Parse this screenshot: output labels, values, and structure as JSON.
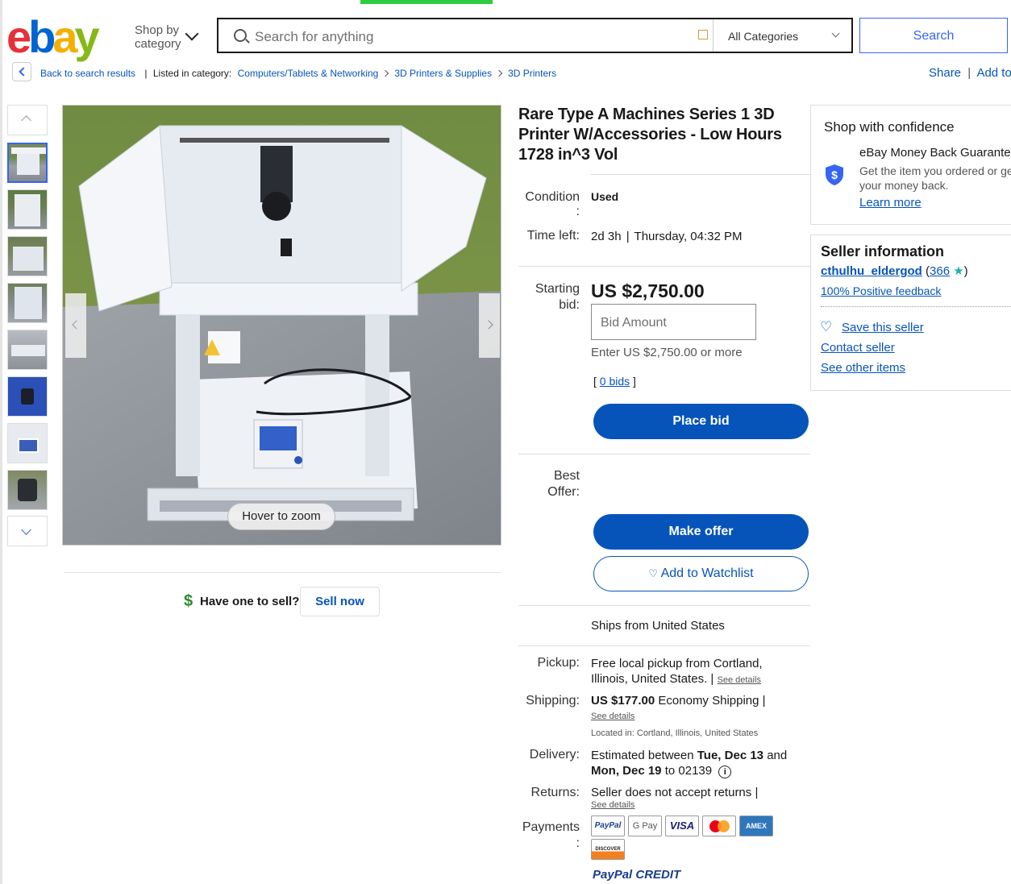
{
  "header": {
    "logo_letters": [
      "e",
      "b",
      "a",
      "y"
    ],
    "logo_colors": [
      "#e53238",
      "#0064d2",
      "#f5af02",
      "#86b817"
    ],
    "shop_by_category": [
      "Shop by",
      "category"
    ],
    "search_placeholder": "Search for anything",
    "category_select": "All Categories",
    "search_button": "Search"
  },
  "breadcrumb": {
    "back": "Back to search results",
    "listed_in": "Listed in category:",
    "items": [
      "Computers/Tablets & Networking",
      "3D Printers & Supplies",
      "3D Printers"
    ],
    "share": "Share",
    "add_to": "Add to"
  },
  "gallery": {
    "hover_zoom": "Hover to zoom",
    "thumbnail_count": 8
  },
  "sell": {
    "question": "Have one to sell?",
    "button": "Sell now"
  },
  "listing": {
    "title": "Rare Type A Machines Series 1 3D Printer W/Accessories - Low Hours 1728 in^3 Vol",
    "condition_label": "Condition",
    "condition_colon": ":",
    "condition_value": "Used",
    "time_left_label": "Time left:",
    "time_left_value": "2d 3h",
    "time_left_end": "Thursday, 04:32 PM",
    "starting_bid_label": [
      "Starting",
      "bid:"
    ],
    "price": "US $2,750.00",
    "bid_placeholder": "Bid Amount",
    "bid_hint": "Enter US $2,750.00 or more",
    "bids_link": "0 bids",
    "place_bid": "Place bid",
    "best_offer_label": [
      "Best",
      "Offer:"
    ],
    "make_offer": "Make offer",
    "add_to_watchlist": "Add to Watchlist",
    "ships_from": "Ships from United States",
    "pickup_label": "Pickup:",
    "pickup_text": [
      "Free local pickup from Cortland,",
      "Illinois, United States."
    ],
    "shipping_label": "Shipping:",
    "shipping_price": "US $177.00",
    "shipping_method": "Economy Shipping",
    "located_in": "Located in: Cortland, Illinois, United States",
    "delivery_label": "Delivery:",
    "delivery_prefix": "Estimated between",
    "delivery_start": "Tue, Dec 13",
    "delivery_and": "and",
    "delivery_end": "Mon, Dec 19",
    "delivery_to": "to 02139",
    "returns_label": "Returns:",
    "returns_text": "Seller does not accept returns",
    "see_details": "See details",
    "payments_label": "Payments",
    "payments_colon": ":",
    "payment_methods": [
      "PayPal",
      "G Pay",
      "VISA",
      "mastercard",
      "AMEX",
      "DISCOVER"
    ],
    "paypal_credit": "PayPal CREDIT"
  },
  "confidence": {
    "heading": "Shop with confidence",
    "guarantee_title": "eBay Money Back Guarantee",
    "guarantee_text": [
      "Get the item you ordered or get",
      "your money back."
    ],
    "learn_more": "Learn more"
  },
  "seller": {
    "heading": "Seller information",
    "name": "cthulhu_eldergod",
    "feedback_count": "366",
    "positive": "100% Positive feedback",
    "save": "Save this seller",
    "contact": "Contact seller",
    "other_items": "See other items"
  },
  "colors": {
    "link_blue": "#0654ba",
    "button_blue": "#0654ba",
    "search_blue": "#3665f3"
  }
}
